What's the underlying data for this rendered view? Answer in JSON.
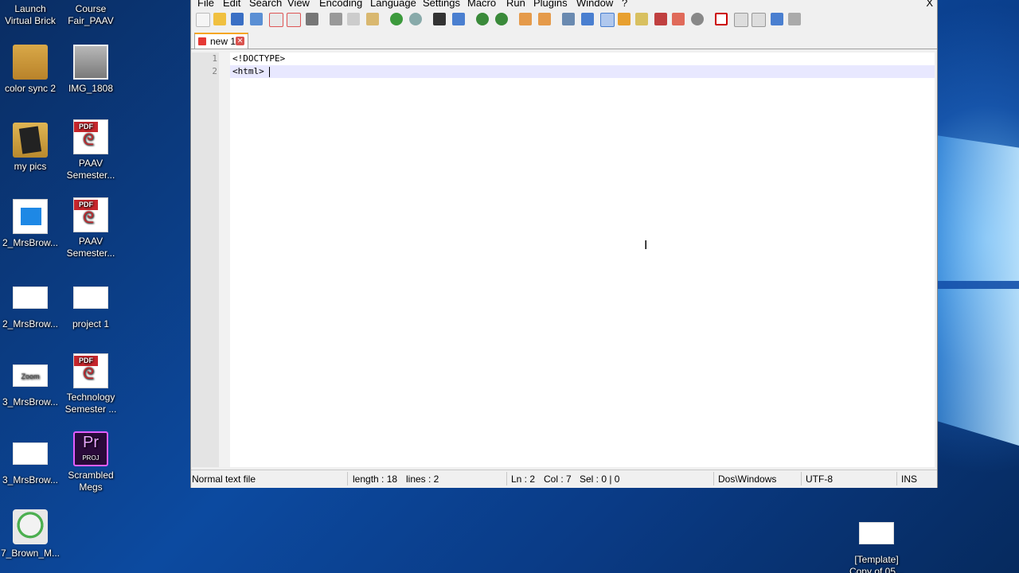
{
  "desktop": {
    "icons": [
      {
        "label": "Launch\nVirtual Brick",
        "type": "shortcut"
      },
      {
        "label": "Course\nFair_PAAV",
        "type": "shortcut"
      },
      {
        "label": "color sync 2",
        "type": "folder"
      },
      {
        "label": "IMG_1808",
        "type": "photo"
      },
      {
        "label": "my pics",
        "type": "folder"
      },
      {
        "label": "PAAV\nSemester...",
        "type": "pdf"
      },
      {
        "label": "2_MrsBrow...",
        "type": "video"
      },
      {
        "label": "PAAV\nSemester...",
        "type": "pdf"
      },
      {
        "label": "2_MrsBrow...",
        "type": "blank"
      },
      {
        "label": "project 1",
        "type": "blank"
      },
      {
        "label": "3_MrsBrow...",
        "type": "zoom"
      },
      {
        "label": "Technology\nSemester ...",
        "type": "pdf"
      },
      {
        "label": "3_MrsBrow...",
        "type": "blank"
      },
      {
        "label": "Scrambled\nMegs",
        "type": "premiere"
      },
      {
        "label": "7_Brown_M...",
        "type": "skull"
      },
      {
        "label": "[Template]\nCopy of 05...",
        "type": "blank"
      }
    ],
    "pdf_badge": "PDF",
    "zoom_text": "Zoom",
    "premiere_text": "Pr",
    "premiere_sub": "PROJ"
  },
  "app": {
    "menu": [
      "File",
      "Edit",
      "Search",
      "View",
      "Encoding",
      "Language",
      "Settings",
      "Macro",
      "Run",
      "Plugins",
      "Window",
      "?"
    ],
    "close_label": "X",
    "tab": {
      "label": "new 1",
      "close": "✕"
    },
    "lines": [
      {
        "number": "1",
        "text": "<!DOCTYPE>"
      },
      {
        "number": "2",
        "text": "<html>"
      }
    ],
    "status": {
      "file_type": "Normal text file",
      "length": "length : 18",
      "lines": "lines : 2",
      "ln": "Ln : 2",
      "col": "Col : 7",
      "sel": "Sel : 0 | 0",
      "eol": "Dos\\Windows",
      "encoding": "UTF-8",
      "mode": "INS"
    }
  },
  "colors": {
    "accent_tab": "#f5a623",
    "current_line": "#e8e8ff",
    "gutter": "#e4e4e4"
  }
}
